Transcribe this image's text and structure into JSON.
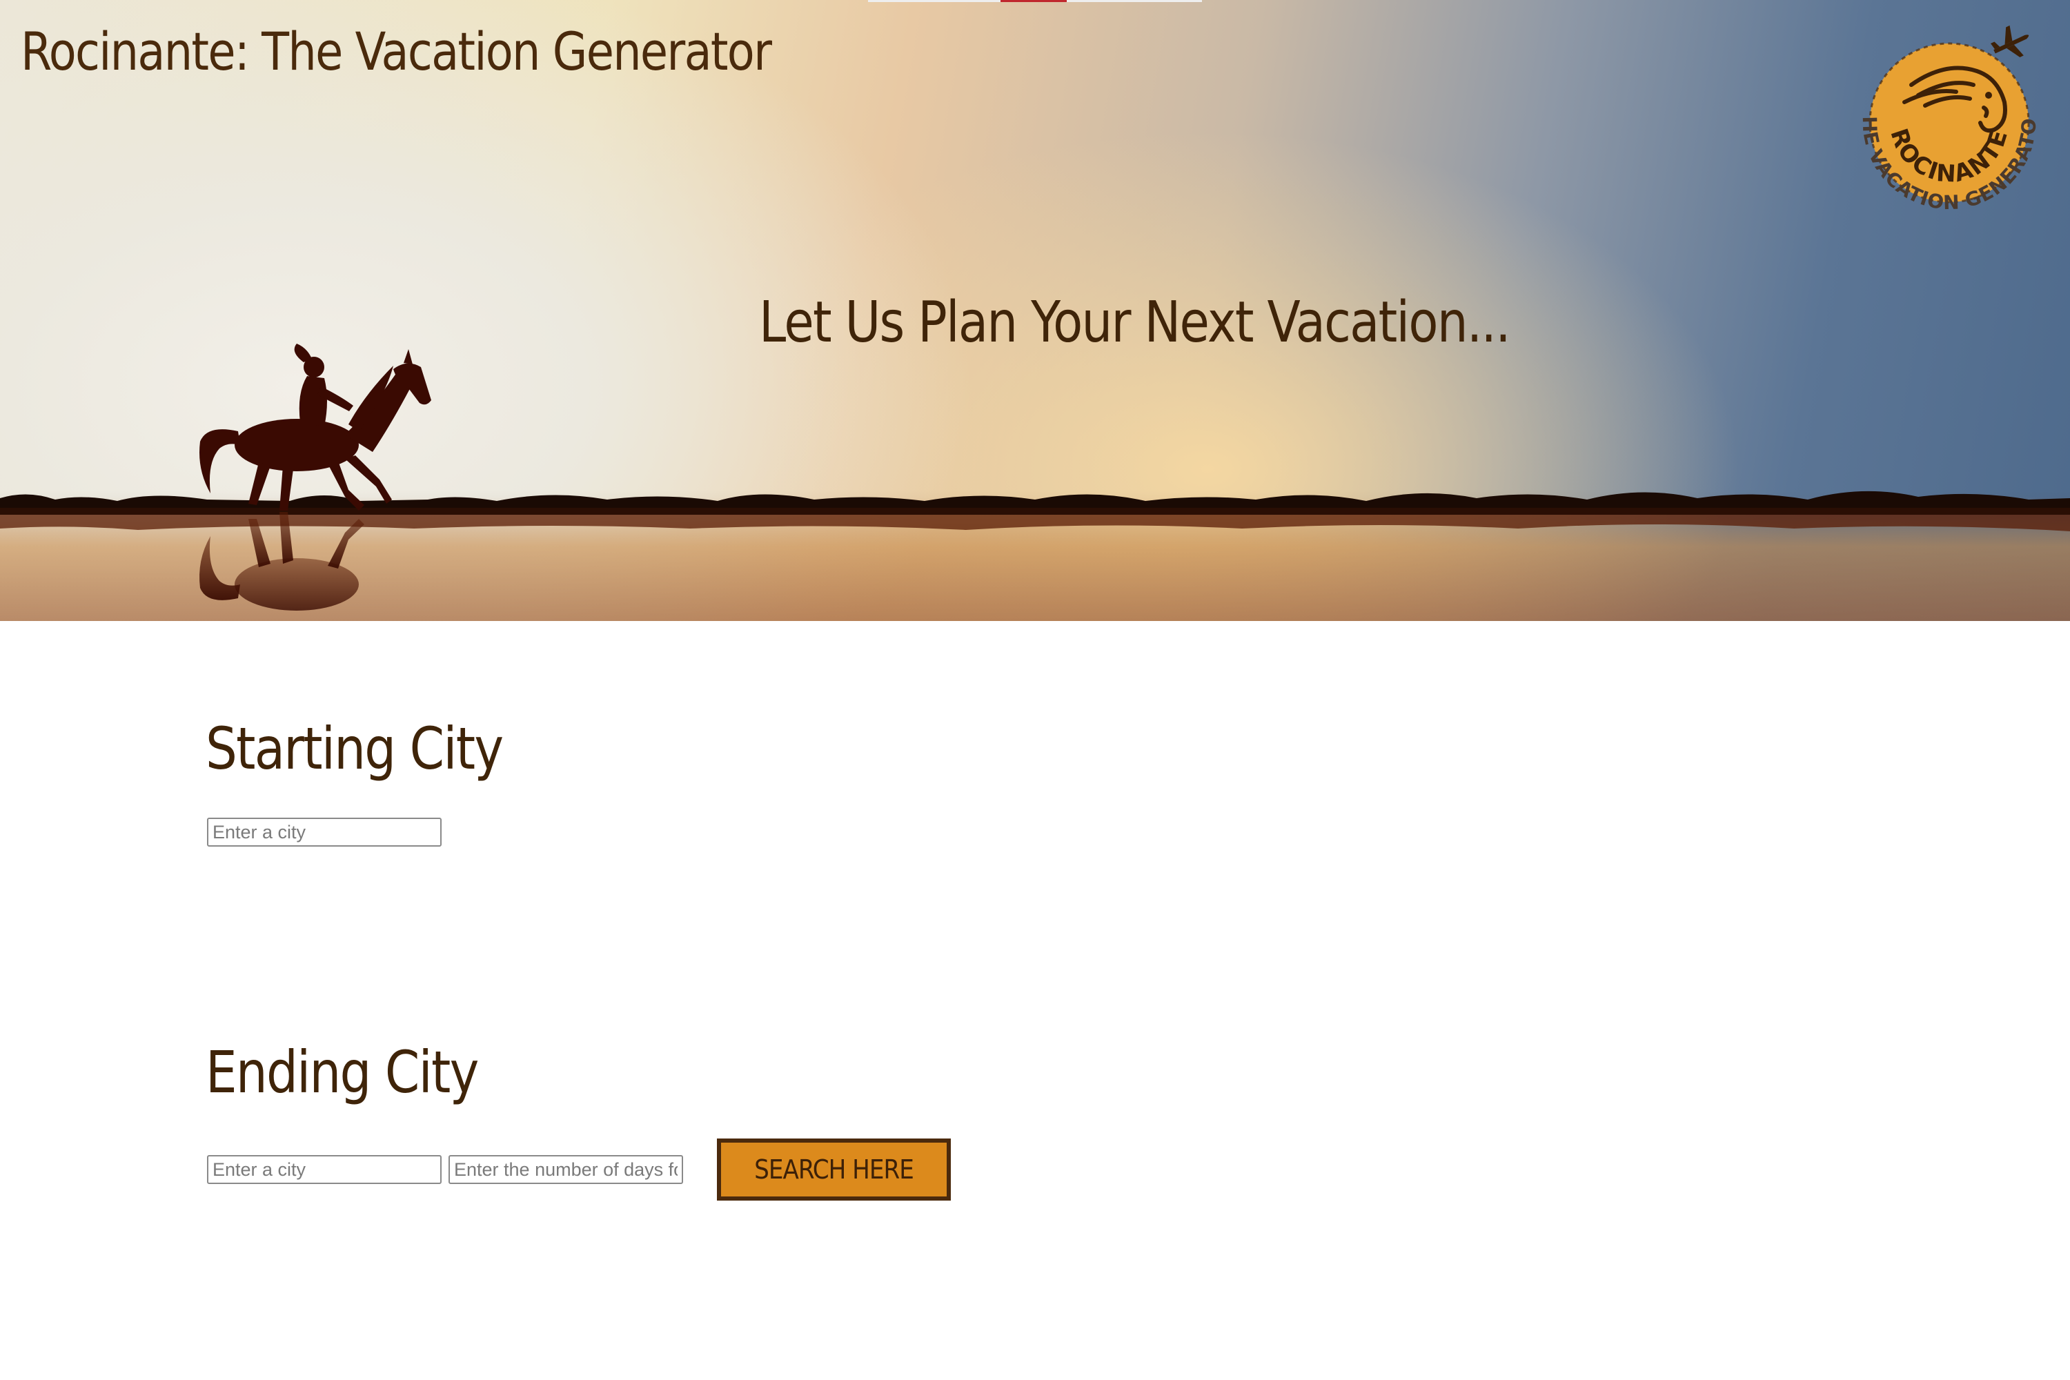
{
  "header": {
    "site_title": "Rocinante: The Vacation Generator",
    "tagline": "Let Us Plan Your Next Vacation..."
  },
  "logo": {
    "top_text": "ROCINANTE",
    "bottom_text": "THE VACATION GENERATOR",
    "icons": [
      "horse-head-icon",
      "airplane-icon"
    ]
  },
  "form": {
    "starting_city": {
      "heading": "Starting City",
      "placeholder": "Enter a city"
    },
    "ending_city": {
      "heading": "Ending City",
      "placeholder": "Enter a city"
    },
    "days": {
      "placeholder": "Enter the number of days for your trip"
    },
    "search_button_label": "SEARCH HERE"
  },
  "colors": {
    "brand_brown": "#4a2a0c",
    "button_orange": "#dc8a1c",
    "logo_orange": "#e8a132",
    "accent_red": "#c0272d"
  }
}
